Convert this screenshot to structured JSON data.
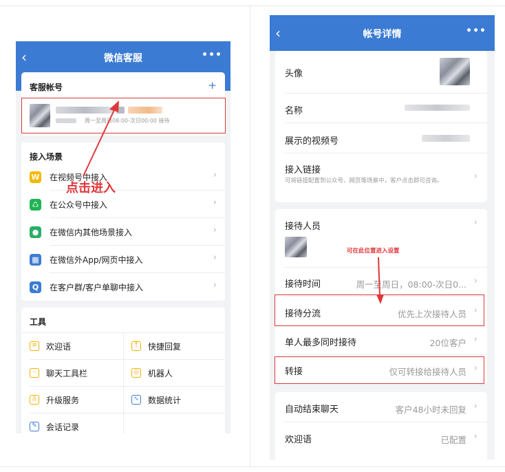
{
  "left": {
    "nav": {
      "back": "‹",
      "title": "微信客服",
      "more": "•••"
    },
    "account": {
      "title": "客服帐号",
      "add": "+",
      "schedule": "周一至周日08:00-次日00:00 接待"
    },
    "scenes": {
      "title": "接入场景",
      "items": [
        {
          "label": "在视频号中接入",
          "icon": "video-channel-icon",
          "color": "#f5b800"
        },
        {
          "label": "在公众号中接入",
          "icon": "official-account-icon",
          "color": "#20b455"
        },
        {
          "label": "在微信内其他场景接入",
          "icon": "wechat-icon",
          "color": "#2aae67"
        },
        {
          "label": "在微信外App/网页中接入",
          "icon": "grid-app-icon",
          "color": "#3b7bd3"
        },
        {
          "label": "在客户群/客户单聊中接入",
          "icon": "chat-group-icon",
          "color": "#3b7bd3"
        }
      ]
    },
    "tools": {
      "title": "工具",
      "items": [
        {
          "label": "欢迎语",
          "icon": "welcome-icon",
          "color": "#f0b000"
        },
        {
          "label": "快捷回复",
          "icon": "quick-reply-icon",
          "color": "#f0b000"
        },
        {
          "label": "聊天工具栏",
          "icon": "toolbar-icon",
          "color": "#f0b000"
        },
        {
          "label": "机器人",
          "icon": "robot-icon",
          "color": "#f0b000"
        },
        {
          "label": "升级服务",
          "icon": "upgrade-service-icon",
          "color": "#f0b000"
        },
        {
          "label": "数据统计",
          "icon": "statistics-icon",
          "color": "#3b7bd3"
        },
        {
          "label": "会话记录",
          "icon": "chat-record-icon",
          "color": "#3b7bd3"
        }
      ]
    },
    "annotation": "点击进入"
  },
  "right": {
    "nav": {
      "back": "‹",
      "title": "帐号详情",
      "more": "•••"
    },
    "rows": {
      "avatar": "头像",
      "name": "名称",
      "channel": "展示的视频号",
      "link": "接入链接",
      "link_desc": "可将链接配置到公众号、网页等场景中，客户点击即可咨询。",
      "staff": "接待人员",
      "time": "接待时间",
      "time_val": "周一至周日，08:00-次日0...",
      "route": "接待分流",
      "route_val": "优先上次接待人员",
      "max": "单人最多同时接待",
      "max_val": "20位客户",
      "transfer": "转接",
      "transfer_val": "仅可转接给接待人员",
      "auto_end": "自动结束聊天",
      "auto_end_val": "客户48小时未回复",
      "welcome": "欢迎语",
      "welcome_val": "已配置"
    },
    "annotation": "可在此位置进入设置"
  },
  "chevron": "›",
  "colors": {
    "primary": "#3b7bd3",
    "annotation": "#e0373a"
  }
}
